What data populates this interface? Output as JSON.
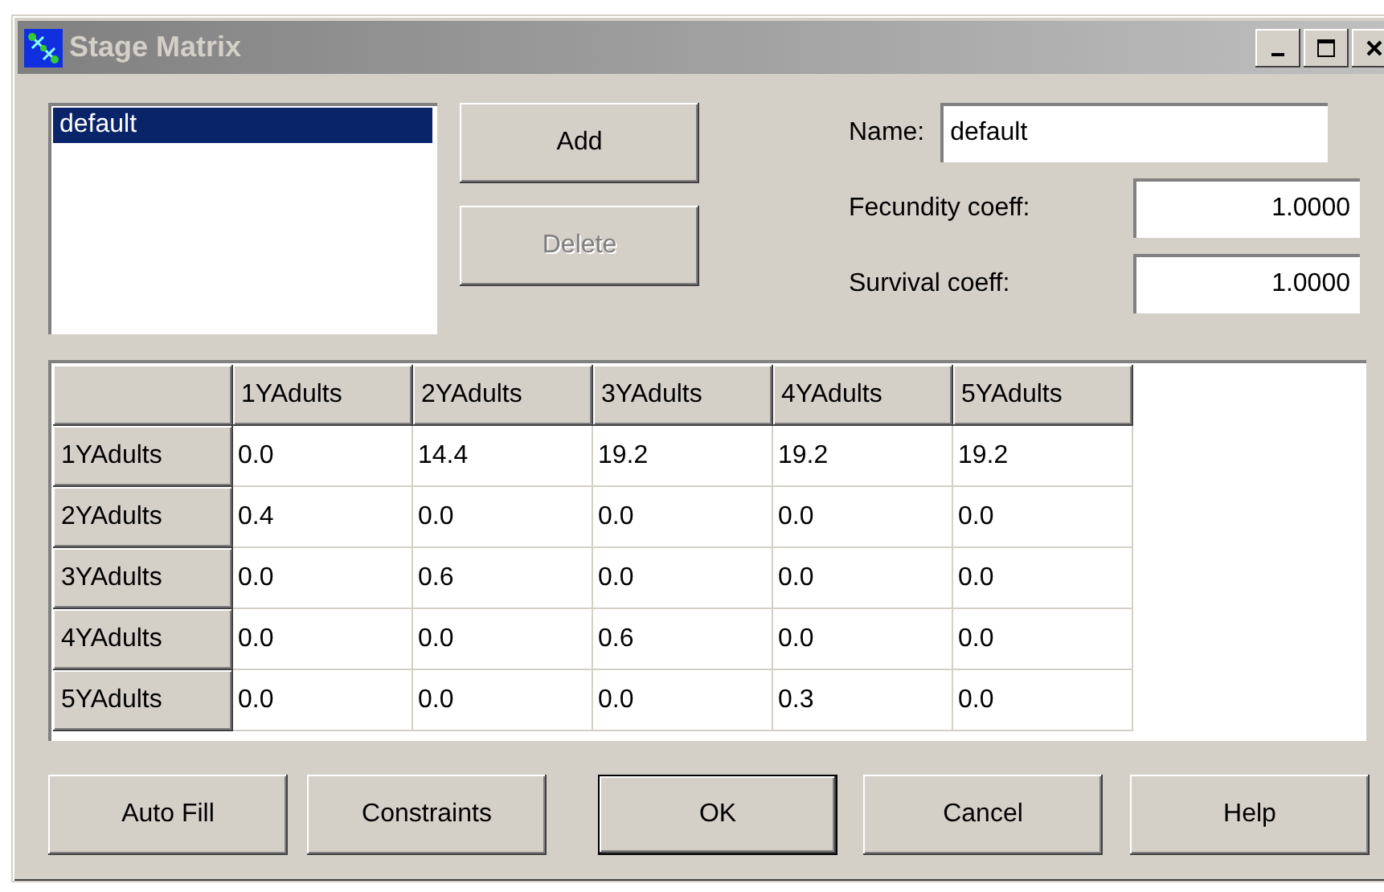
{
  "window": {
    "title": "Stage Matrix"
  },
  "list": {
    "items": [
      {
        "label": "default",
        "selected": true
      }
    ]
  },
  "buttons_top": [
    {
      "label": "Add",
      "disabled": false
    },
    {
      "label": "Delete",
      "disabled": true
    }
  ],
  "fields": [
    {
      "label": "Name:",
      "value": "default",
      "kind": "text"
    },
    {
      "label": "Fecundity coeff:",
      "value": "1.0000",
      "kind": "number"
    },
    {
      "label": "Survival coeff:",
      "value": "1.0000",
      "kind": "number"
    }
  ],
  "table": {
    "columns": [
      "1YAdults",
      "2YAdults",
      "3YAdults",
      "4YAdults",
      "5YAdults"
    ],
    "rows": [
      {
        "header": "1YAdults",
        "cells": [
          "0.0",
          "14.4",
          "19.2",
          "19.2",
          "19.2"
        ]
      },
      {
        "header": "2YAdults",
        "cells": [
          "0.4",
          "0.0",
          "0.0",
          "0.0",
          "0.0"
        ]
      },
      {
        "header": "3YAdults",
        "cells": [
          "0.0",
          "0.6",
          "0.0",
          "0.0",
          "0.0"
        ]
      },
      {
        "header": "4YAdults",
        "cells": [
          "0.0",
          "0.0",
          "0.6",
          "0.0",
          "0.0"
        ]
      },
      {
        "header": "5YAdults",
        "cells": [
          "0.0",
          "0.0",
          "0.0",
          "0.3",
          "0.0"
        ]
      }
    ]
  },
  "buttons_bottom": [
    {
      "label": "Auto Fill",
      "default": false
    },
    {
      "label": "Constraints",
      "default": false
    },
    {
      "label": "OK",
      "default": true
    },
    {
      "label": "Cancel",
      "default": false
    },
    {
      "label": "Help",
      "default": false
    }
  ]
}
